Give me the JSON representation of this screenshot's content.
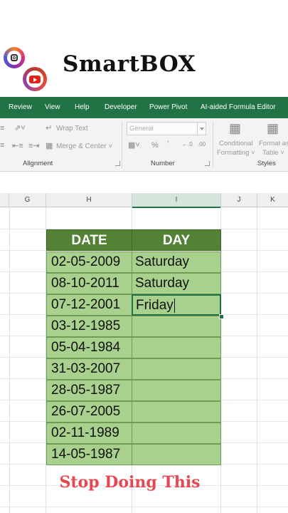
{
  "brand": {
    "name": "SmartBOX",
    "social": [
      "instagram-icon",
      "youtube-icon"
    ]
  },
  "ribbon": {
    "tabs": [
      "Review",
      "View",
      "Help",
      "Developer",
      "Power Pivot",
      "AI-aided Formula Editor"
    ],
    "alignment": {
      "wrap_text": "Wrap Text",
      "merge_center": "Merge & Center",
      "label": "Alignment"
    },
    "number": {
      "format_value": "General",
      "percent": "%",
      "comma": "’",
      "inc_dec": "←.0",
      "dec_dec": ".00",
      "label": "Number"
    },
    "styles": {
      "conditional": "Conditional",
      "formatting": "Formatting ˅",
      "format_as": "Format as",
      "table": "Table ˅",
      "label": "Styles"
    }
  },
  "columns": [
    "G",
    "H",
    "I",
    "J",
    "K"
  ],
  "table": {
    "headers": {
      "date": "DATE",
      "day": "DAY"
    },
    "rows": [
      {
        "date": "02-05-2009",
        "day": "Saturday"
      },
      {
        "date": "08-10-2011",
        "day": "Saturday"
      },
      {
        "date": "07-12-2001",
        "day": "Friday"
      },
      {
        "date": "03-12-1985",
        "day": ""
      },
      {
        "date": "05-04-1984",
        "day": ""
      },
      {
        "date": "31-03-2007",
        "day": ""
      },
      {
        "date": "28-05-1987",
        "day": ""
      },
      {
        "date": "26-07-2005",
        "day": ""
      },
      {
        "date": "02-11-1989",
        "day": ""
      },
      {
        "date": "14-05-1987",
        "day": ""
      }
    ]
  },
  "caption": "Stop Doing This",
  "colors": {
    "excel_green": "#217346",
    "header_green": "#548235",
    "cell_green": "#a9d18e",
    "caption_red": "#e8474f"
  }
}
